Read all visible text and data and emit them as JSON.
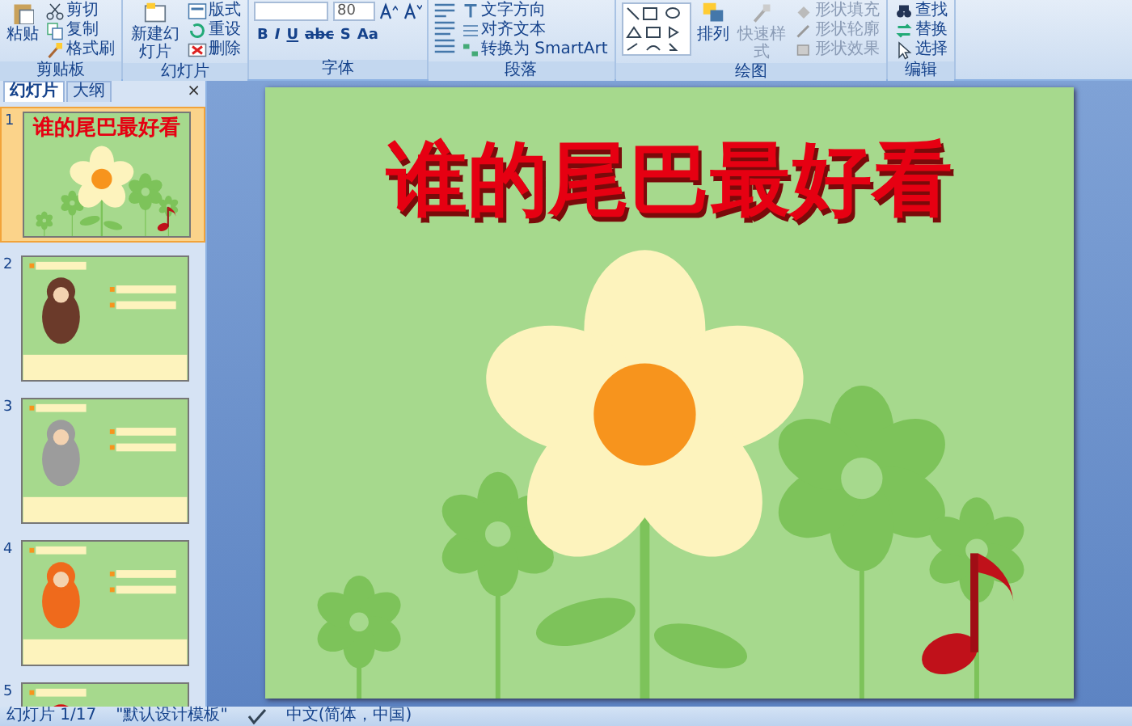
{
  "ribbon": {
    "groups": [
      {
        "label": "剪贴板",
        "items": [
          {
            "kind": "large",
            "label": "粘贴"
          },
          {
            "kind": "small",
            "label": "剪切"
          },
          {
            "kind": "small",
            "label": "复制"
          },
          {
            "kind": "small",
            "label": "格式刷"
          }
        ]
      },
      {
        "label": "幻灯片",
        "items": [
          {
            "kind": "large",
            "label": "新建幻灯片"
          },
          {
            "kind": "small",
            "label": "版式"
          },
          {
            "kind": "small",
            "label": "重设"
          },
          {
            "kind": "small",
            "label": "删除"
          }
        ]
      },
      {
        "label": "字体",
        "items": [
          {
            "kind": "field",
            "value": "80"
          },
          {
            "kind": "glyph",
            "label": "B"
          },
          {
            "kind": "glyph",
            "label": "I"
          },
          {
            "kind": "glyph",
            "label": "U"
          },
          {
            "kind": "glyph",
            "label": "abc"
          },
          {
            "kind": "glyph",
            "label": "S"
          },
          {
            "kind": "glyph",
            "label": "Aa"
          }
        ]
      },
      {
        "label": "段落",
        "items": [
          {
            "kind": "small",
            "label": "文字方向"
          },
          {
            "kind": "small",
            "label": "对齐文本"
          },
          {
            "kind": "small",
            "label": "转换为 SmartArt"
          }
        ]
      },
      {
        "label": "绘图",
        "items": [
          {
            "kind": "large",
            "label": "排列",
            "disabled": false
          },
          {
            "kind": "large",
            "label": "快速样式",
            "disabled": true
          },
          {
            "kind": "small",
            "label": "形状填充",
            "disabled": true
          },
          {
            "kind": "small",
            "label": "形状轮廓",
            "disabled": true
          },
          {
            "kind": "small",
            "label": "形状效果",
            "disabled": true
          }
        ]
      },
      {
        "label": "编辑",
        "items": [
          {
            "kind": "small",
            "label": "查找"
          },
          {
            "kind": "small",
            "label": "替换"
          },
          {
            "kind": "small",
            "label": "选择"
          }
        ]
      }
    ]
  },
  "panel": {
    "tabs": [
      {
        "label": "幻灯片",
        "selected": true
      },
      {
        "label": "大纲",
        "selected": false
      }
    ],
    "close": "×",
    "slides": [
      {
        "number": "1",
        "selected": true,
        "kind": "title",
        "title": "谁的尾巴最好看"
      },
      {
        "number": "2",
        "selected": false,
        "kind": "question"
      },
      {
        "number": "3",
        "selected": false,
        "kind": "question"
      },
      {
        "number": "4",
        "selected": false,
        "kind": "question"
      },
      {
        "number": "5",
        "selected": false,
        "kind": "question"
      }
    ]
  },
  "slide": {
    "title": "谁的尾巴最好看"
  },
  "status_bar": {
    "slide_counter": "幻灯片 1/17",
    "theme": "\"默认设计模板\"",
    "language": "中文(简体，中国)"
  }
}
